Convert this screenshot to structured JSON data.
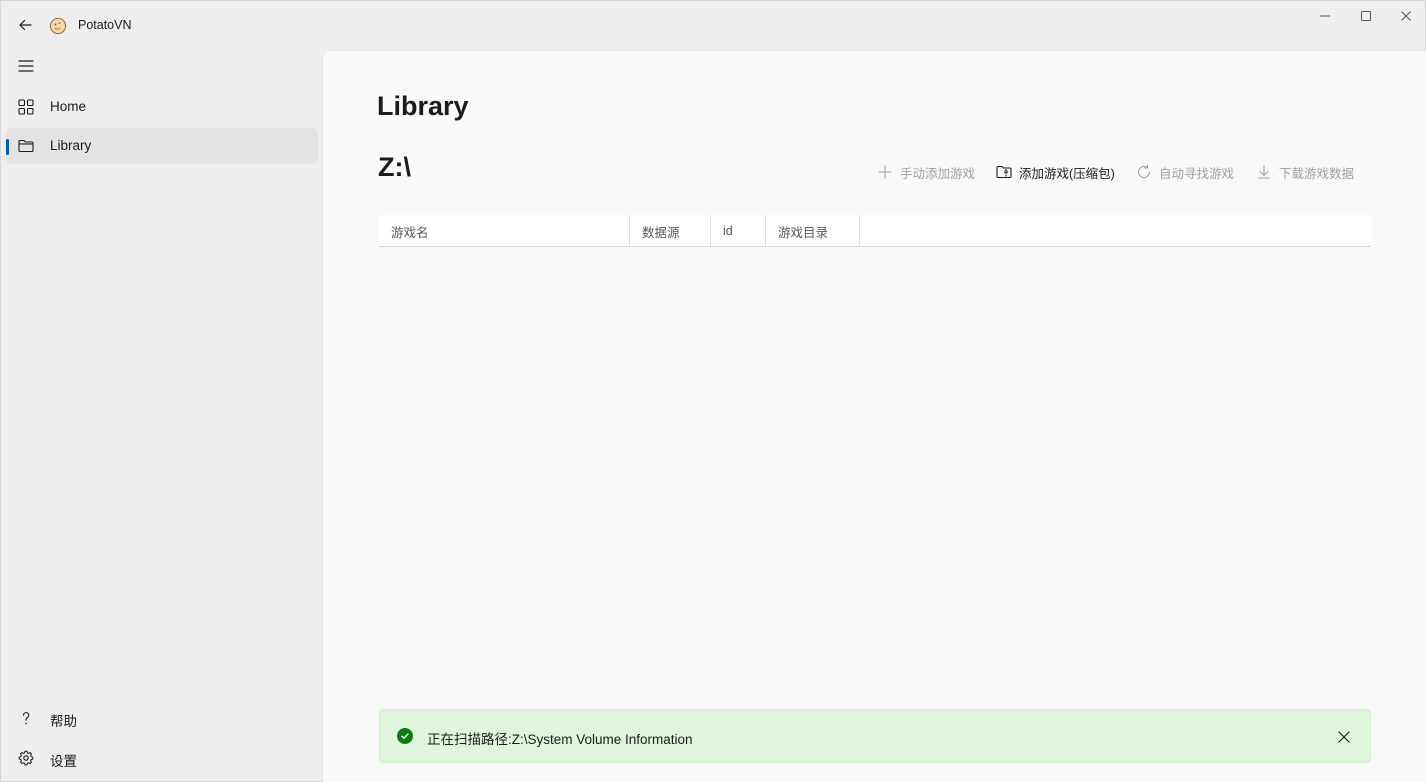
{
  "titlebar": {
    "app_title": "PotatoVN",
    "icons": {
      "back": "back-arrow-icon",
      "logo": "potato-logo-icon",
      "minimize": "minimize-icon",
      "maximize": "maximize-icon",
      "close": "close-icon"
    }
  },
  "sidebar": {
    "menu_icon": "hamburger-menu-icon",
    "items": [
      {
        "label": "Home",
        "icon": "grid-icon",
        "selected": false
      },
      {
        "label": "Library",
        "icon": "folder-icon",
        "selected": true
      }
    ],
    "footer_items": [
      {
        "label": "帮助",
        "icon": "question-icon"
      },
      {
        "label": "设置",
        "icon": "gear-icon"
      }
    ],
    "accent": "#005fb8"
  },
  "main": {
    "page_title": "Library",
    "path_title": "Z:\\",
    "commands": [
      {
        "label": "手动添加游戏",
        "icon": "plus-icon",
        "enabled": false
      },
      {
        "label": "添加游戏(压缩包)",
        "icon": "archive-folder-icon",
        "enabled": true
      },
      {
        "label": "自动寻找游戏",
        "icon": "refresh-icon",
        "enabled": false
      },
      {
        "label": "下载游戏数据",
        "icon": "download-icon",
        "enabled": false
      }
    ],
    "table": {
      "columns": [
        "游戏名",
        "数据源",
        "id",
        "游戏目录"
      ],
      "rows": []
    },
    "infobar": {
      "severity": "success",
      "icon": "check-circle-icon",
      "message": "正在扫描路径:Z:\\System Volume Information",
      "close_icon": "close-icon",
      "background": "#dff6dd",
      "icon_color": "#0f7b0f"
    }
  }
}
